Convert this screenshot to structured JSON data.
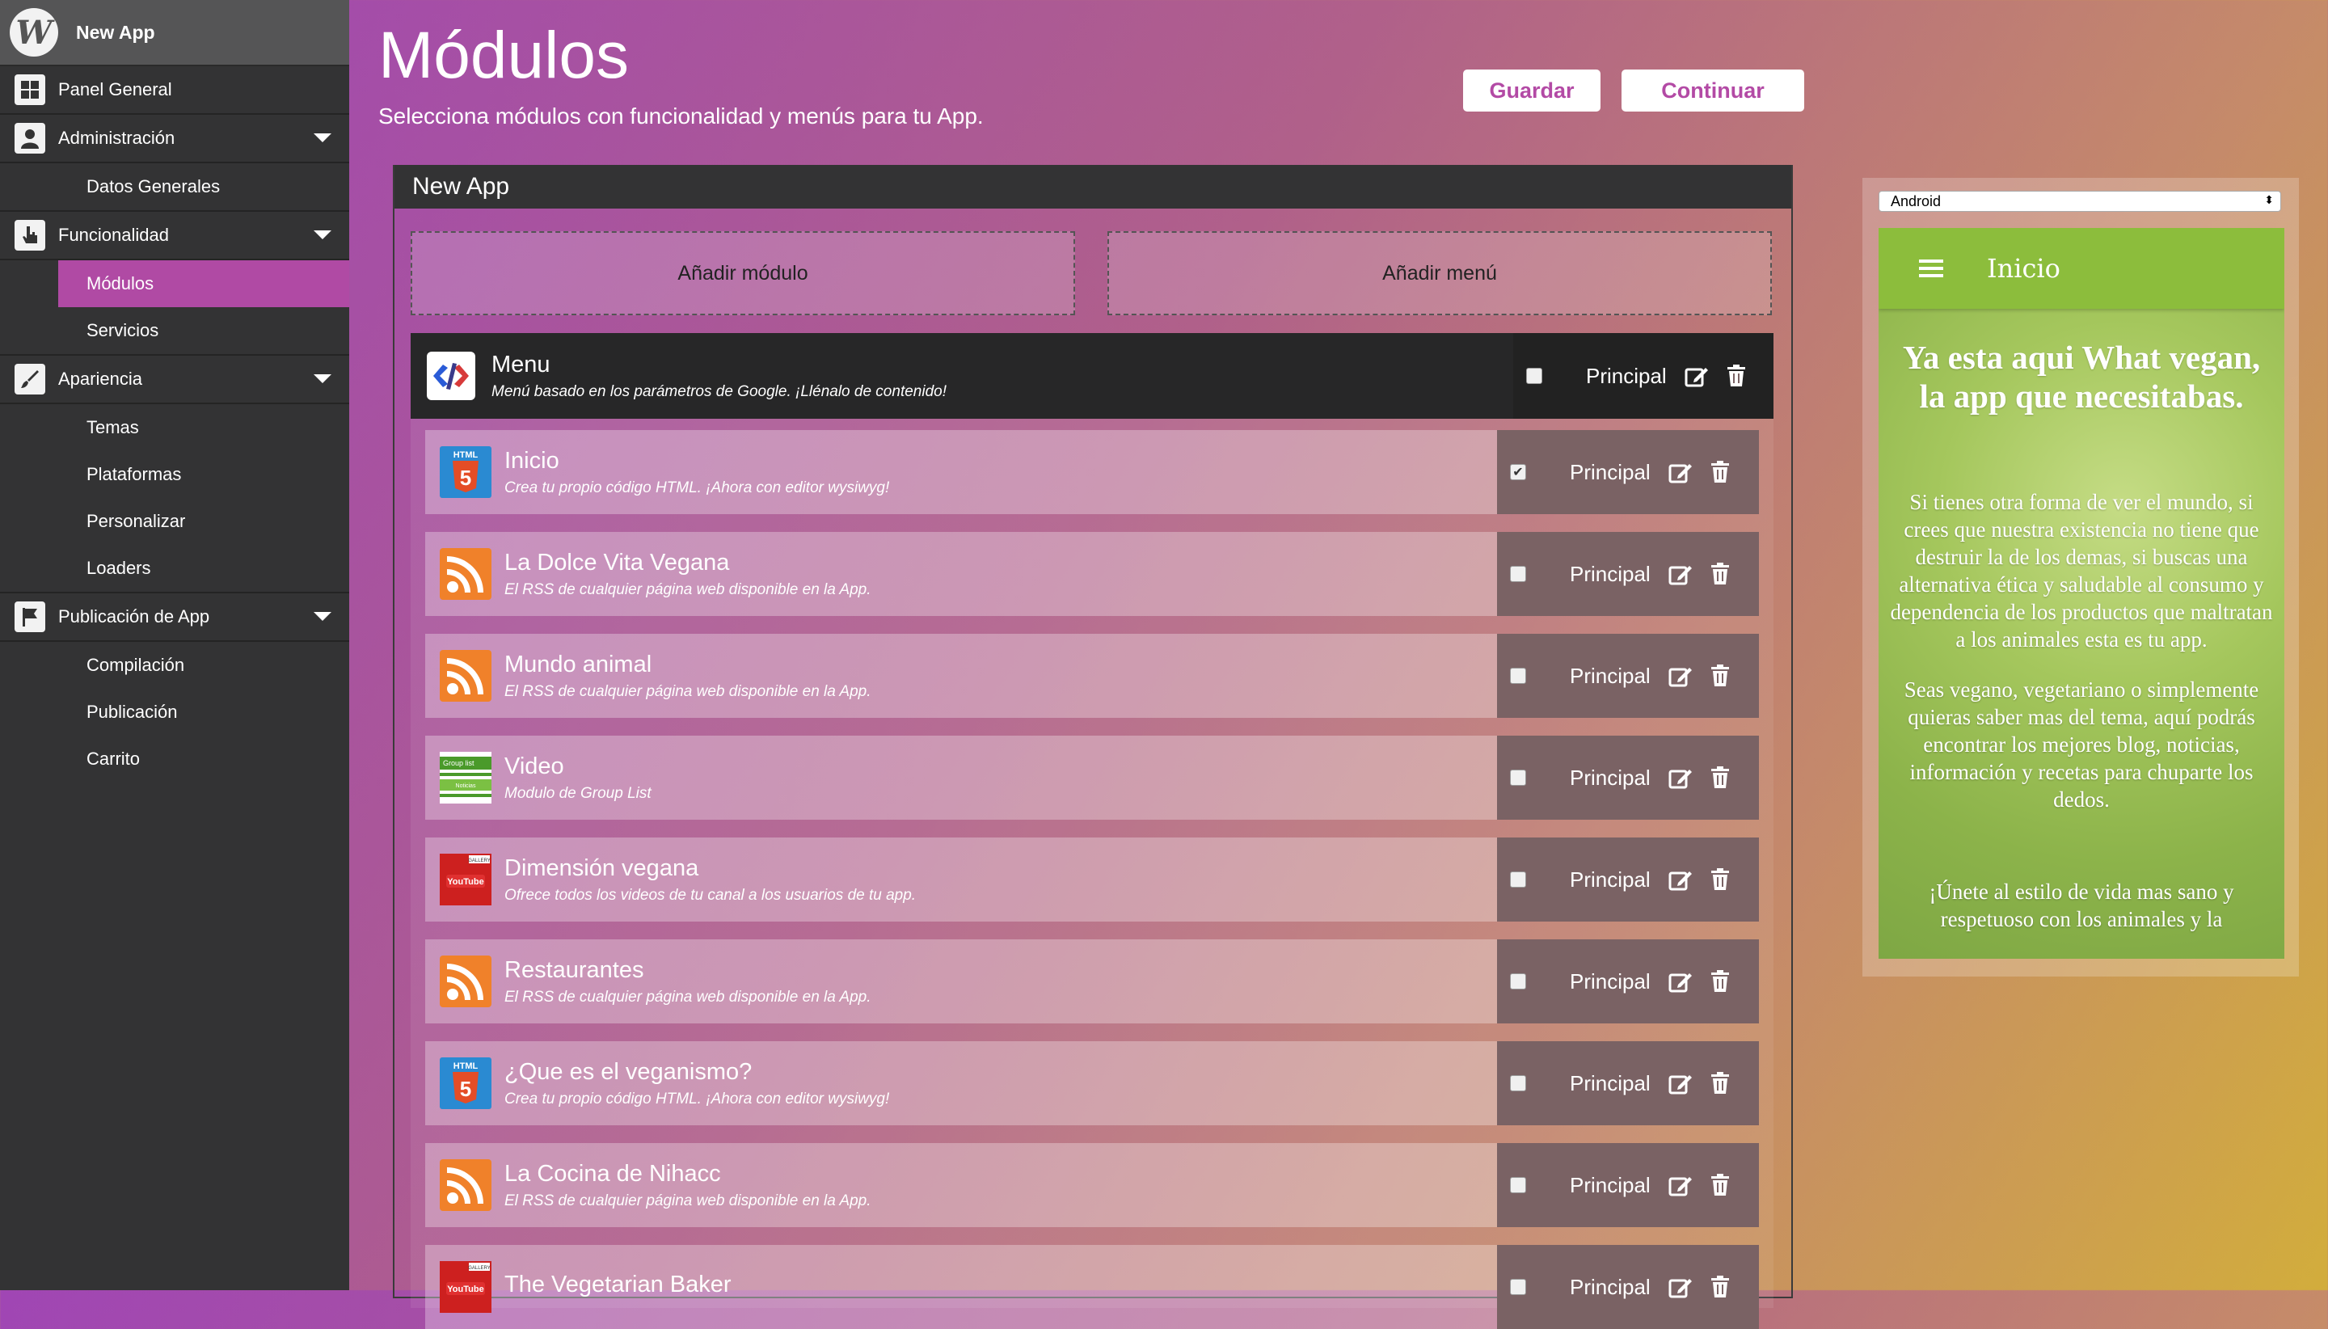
{
  "sidebar": {
    "app_name": "New App",
    "logo_letter": "W",
    "items": [
      {
        "label": "Panel General"
      },
      {
        "label": "Administración"
      },
      {
        "label": "Datos Generales"
      },
      {
        "label": "Funcionalidad"
      },
      {
        "label": "Módulos"
      },
      {
        "label": "Servicios"
      },
      {
        "label": "Apariencia"
      },
      {
        "label": "Temas"
      },
      {
        "label": "Plataformas"
      },
      {
        "label": "Personalizar"
      },
      {
        "label": "Loaders"
      },
      {
        "label": "Publicación de App"
      },
      {
        "label": "Compilación"
      },
      {
        "label": "Publicación"
      },
      {
        "label": "Carrito"
      }
    ]
  },
  "header": {
    "title": "Módulos",
    "subtitle": "Selecciona módulos con funcionalidad y menús para tu App.",
    "save_label": "Guardar",
    "continue_label": "Continuar"
  },
  "panel": {
    "title": "New App",
    "add_module": "Añadir módulo",
    "add_menu": "Añadir menú",
    "menu": {
      "title": "Menu",
      "description": "Menú basado en los parámetros de Google. ¡Llénalo de contenido!",
      "principal": "Principal",
      "checked": false
    },
    "modules": [
      {
        "title": "Inicio",
        "description": "Crea tu propio código HTML. ¡Ahora con editor wysiwyg!",
        "icon": "html5-icon",
        "principal": "Principal",
        "checked": true
      },
      {
        "title": "La Dolce Vita Vegana",
        "description": "El RSS de cualquier página web disponible en la App.",
        "icon": "rss-icon",
        "principal": "Principal",
        "checked": false
      },
      {
        "title": "Mundo animal",
        "description": "El RSS de cualquier página web disponible en la App.",
        "icon": "rss-icon",
        "principal": "Principal",
        "checked": false
      },
      {
        "title": "Video",
        "description": "Modulo de Group List",
        "icon": "group-list-icon",
        "principal": "Principal",
        "checked": false
      },
      {
        "title": "Dimensión vegana",
        "description": "Ofrece todos los videos de tu canal a los usuarios de tu app.",
        "icon": "youtube-icon",
        "principal": "Principal",
        "checked": false
      },
      {
        "title": "Restaurantes",
        "description": "El RSS de cualquier página web disponible en la App.",
        "icon": "rss-icon",
        "principal": "Principal",
        "checked": false
      },
      {
        "title": "¿Que es el veganismo?",
        "description": "Crea tu propio código HTML. ¡Ahora con editor wysiwyg!",
        "icon": "html5-icon",
        "principal": "Principal",
        "checked": false
      },
      {
        "title": "La Cocina de Nihacc",
        "description": "El RSS de cualquier página web disponible en la App.",
        "icon": "rss-icon",
        "principal": "Principal",
        "checked": false
      },
      {
        "title": "The Vegetarian Baker",
        "description": "",
        "icon": "youtube-icon",
        "principal": "Principal",
        "checked": false
      }
    ],
    "icon_labels": {
      "html": "HTML",
      "html_num": "5",
      "group_list": "Group list",
      "group_sub": "Noticias",
      "youtube": "YouTube",
      "youtube_tag": "GALLERY"
    }
  },
  "preview": {
    "platform": "Android",
    "app_title": "Inicio",
    "heading": "Ya esta aqui What vegan, la app que necesitabas.",
    "paragraph1": "Si tienes otra forma de ver el mundo, si crees que nuestra existencia no tiene que destruir la de los demas, si buscas una alternativa ética y saludable al consumo y dependencia de los productos que maltratan a los animales esta es tu app.",
    "paragraph2": "Seas vegano, vegetariano o simplemente quieras saber mas del tema, aquí podrás encontrar los mejores blog, noticias, información y recetas para chuparte los dedos.",
    "paragraph3": "¡Únete al estilo de vida mas sano y respetuoso con los animales y la"
  },
  "colors": {
    "accent": "#b04aa4",
    "sidebar_bg": "#333334",
    "phone_bar": "#8cbd3c",
    "rss": "#f0812a",
    "html5": "#e44d26",
    "youtube": "#cd201f"
  }
}
